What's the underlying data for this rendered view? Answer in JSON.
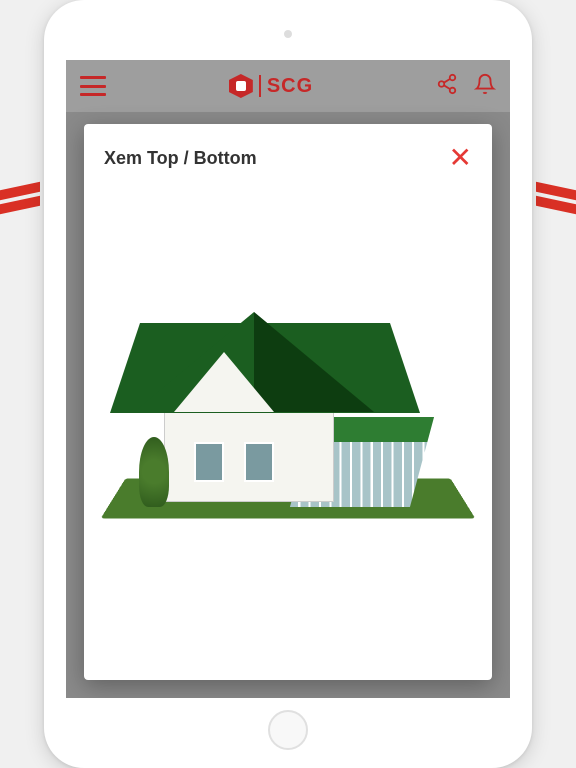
{
  "header": {
    "brand": "SCG"
  },
  "modal": {
    "title": "Xem Top / Bottom",
    "close": "✕"
  },
  "colors": {
    "accent": "#c62828",
    "roof": "#1b5e20"
  }
}
